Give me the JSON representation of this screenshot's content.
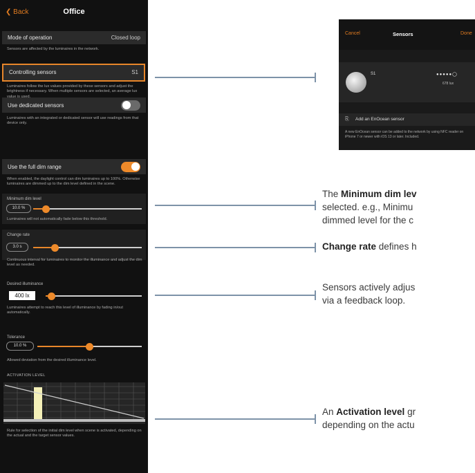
{
  "phone": {
    "back_label": "Back",
    "title": "Office",
    "mode": {
      "label": "Mode of operation",
      "value": "Closed loop",
      "note": "Sensors are affected by the luminaires in the network."
    },
    "controlling": {
      "label": "Controlling sensors",
      "value": "S1",
      "note": "Luminaires follow the lux values provided by these sensors and adjust the brightness if necessary. When multiple sensors are selected, an average lux value is used."
    },
    "dedicated": {
      "label": "Use dedicated sensors",
      "on": false,
      "note": "Luminaires with an integrated or dedicated sensor will use readings from that device only."
    },
    "fullrange": {
      "label": "Use the full dim range",
      "on": true,
      "note": "When enabled, the daylight control can dim luminaires up to 100%. Otherwise luminaires are dimmed up to the dim level defined in the scene."
    },
    "min_dim": {
      "label": "Minimum dim level",
      "value": "10.0 %",
      "level": 0.12,
      "note": "Luminaires will not automatically fade below this threshold."
    },
    "change_rate": {
      "label": "Change rate",
      "value": "3.0 s",
      "level": 0.2,
      "note": "Continuous interval for luminaires to monitor the illuminance and adjust the dim level as needed."
    },
    "desired": {
      "label": "Desired illuminance",
      "value": "400 lx",
      "level": 0.06,
      "note": "Luminaires attempt to reach this level of illuminance by fading in/out automatically."
    },
    "tolerance": {
      "label": "Tolerance",
      "value": "10.0 %",
      "level": 0.5,
      "note": "Allowed deviation from the desired illuminance level."
    },
    "activation": {
      "label": "ACTIVATION LEVEL",
      "note": "Rule for selection of the initial dim level when scene is activated, depending on the actual and the target sensor values."
    }
  },
  "sensors_panel": {
    "cancel": "Cancel",
    "title": "Sensors",
    "done": "Done",
    "sensor_name": "S1",
    "signal": "●●●●●◯",
    "lux": "678 lux",
    "add_label": "Add an EnOcean sensor",
    "note": "A new EnOcean sensor can be added to the network by using NFC reader on iPhone 7 or newer with iOS 13 or later. Included."
  },
  "descriptions": {
    "min_dim": {
      "bold": "Minimum dim lev",
      "rest1": "",
      "line2": "selected. e.g., Minimu",
      "line3": "dimmed level for the c"
    },
    "change_rate": {
      "bold": "Change rate",
      "rest": " defines h"
    },
    "sensors": {
      "line1": "Sensors actively adjus",
      "line2": "via a feedback loop."
    },
    "activation": {
      "pre": "An ",
      "bold": "Activation level",
      "rest": " gr",
      "line2": "depending on the actu"
    }
  },
  "colors": {
    "accent": "#ee8a2a",
    "connector": "#7d92a8",
    "panel_bg": "#111111"
  }
}
